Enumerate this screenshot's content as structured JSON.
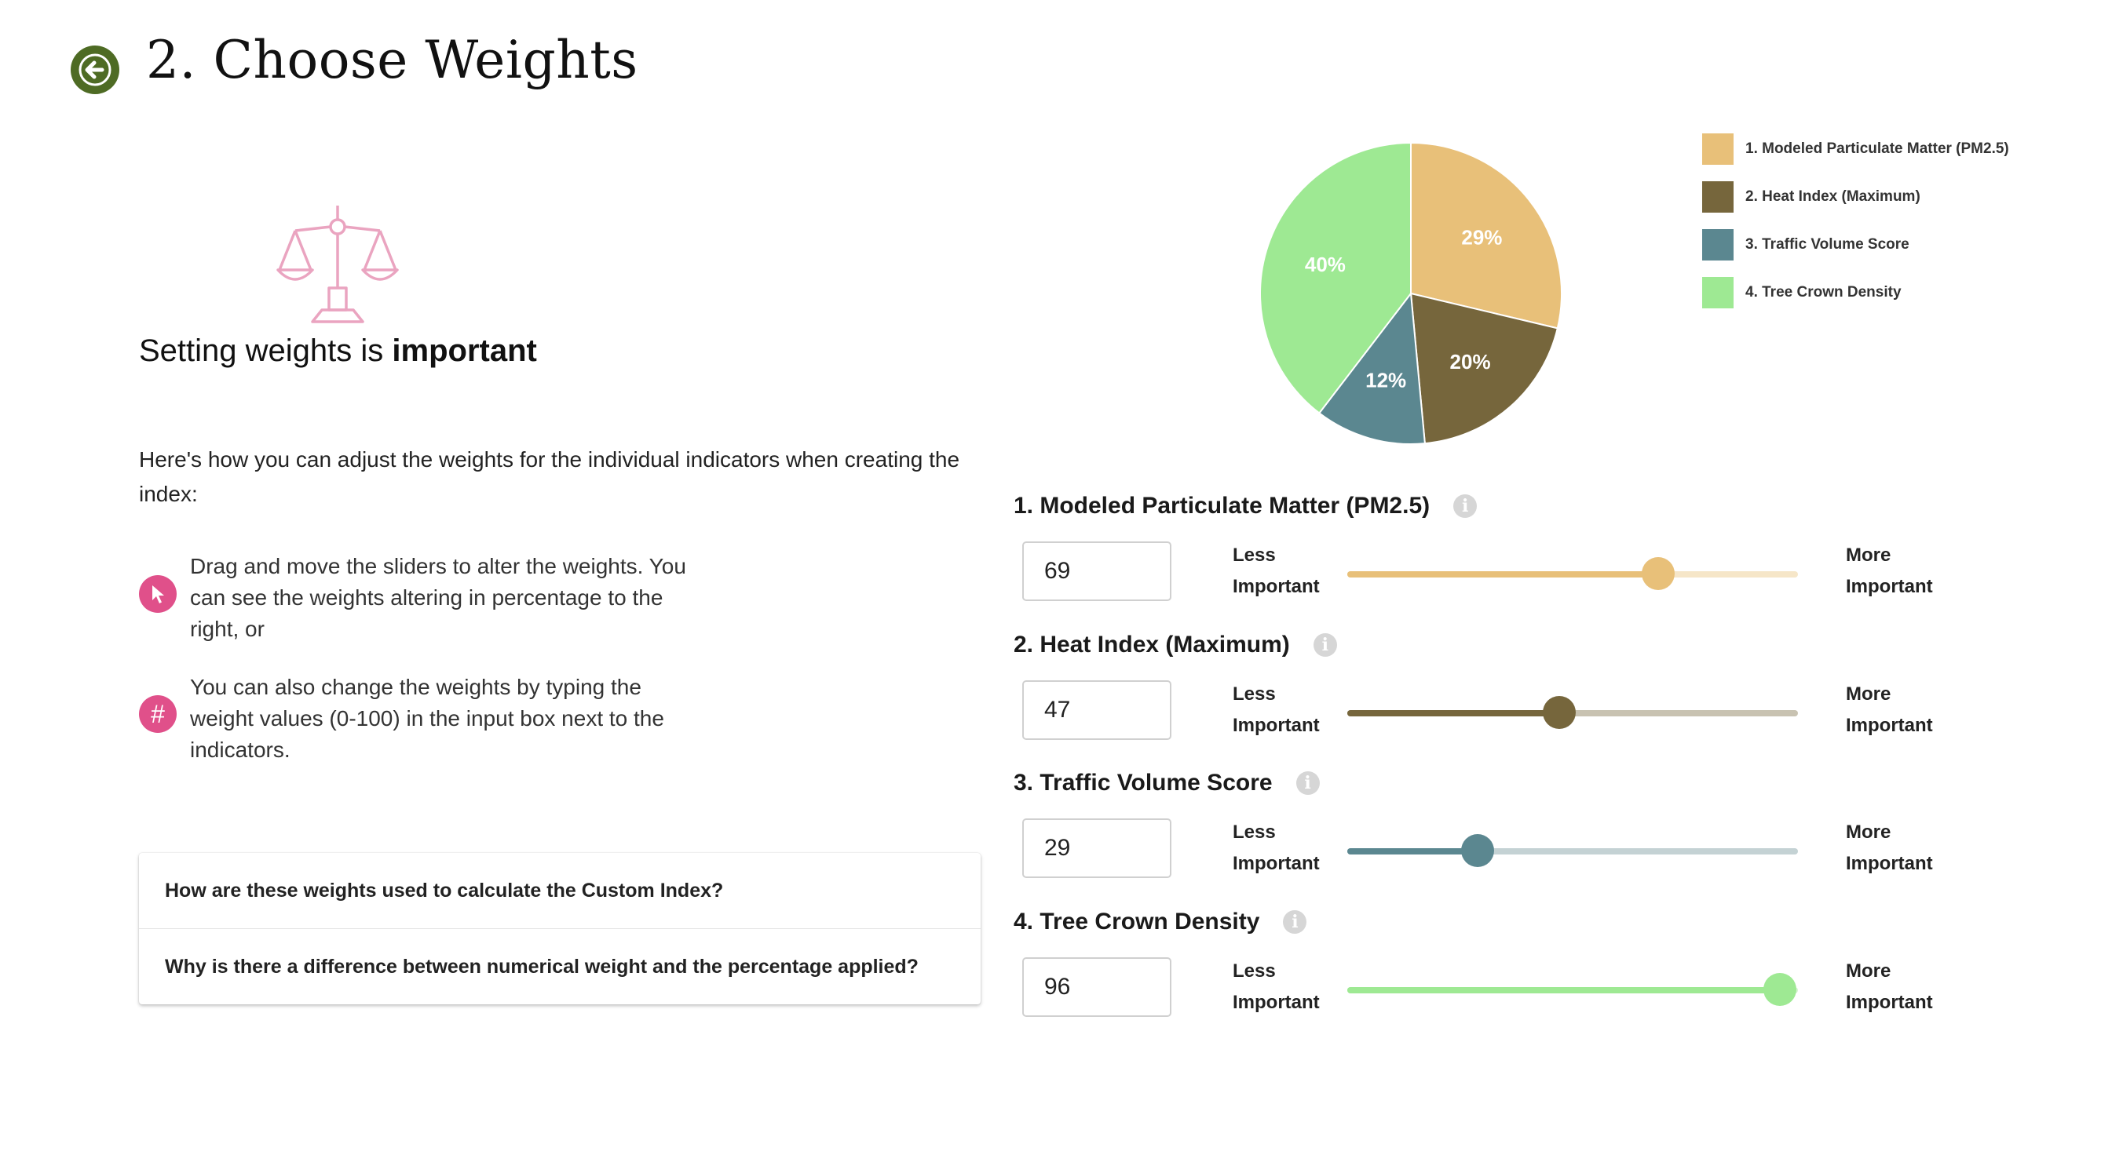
{
  "header": {
    "title": "2. Choose Weights"
  },
  "intro": {
    "heading_prefix": "Setting weights is ",
    "heading_bold": "important",
    "text": "Here's how you can adjust the weights for the individual indicators when creating the index:"
  },
  "tips": [
    {
      "icon": "cursor-icon",
      "text": "Drag and move the sliders to alter the weights. You can see the weights altering in percentage to the right, or"
    },
    {
      "icon": "hash-icon",
      "text": "You can also change the weights by typing the weight values (0-100) in the input box next to the indicators."
    }
  ],
  "faq": [
    "How are these weights used to calculate the Custom Index?",
    "Why is there a difference between numerical weight and the percentage applied?"
  ],
  "labels": {
    "less": [
      "Less",
      "Important"
    ],
    "more": [
      "More",
      "Important"
    ]
  },
  "indicators": [
    {
      "title": "1. Modeled Particulate Matter (PM2.5)",
      "value": "69",
      "slider_fraction": 0.69,
      "color": "#e8c079",
      "light": "#f6e6c8"
    },
    {
      "title": "2. Heat Index (Maximum)",
      "value": "47",
      "slider_fraction": 0.47,
      "color": "#76663c",
      "light": "#c8c2b1"
    },
    {
      "title": "3. Traffic Volume Score",
      "value": "29",
      "slider_fraction": 0.29,
      "color": "#5b8790",
      "light": "#c4d2d4"
    },
    {
      "title": "4. Tree Crown Density",
      "value": "96",
      "slider_fraction": 0.96,
      "color": "#9ee993",
      "light": "#d4f3cf"
    }
  ],
  "chart_data": {
    "type": "pie",
    "labels": [
      "1. Modeled Particulate Matter (PM2.5)",
      "2. Heat Index (Maximum)",
      "3. Traffic Volume Score",
      "4. Tree Crown Density"
    ],
    "values": [
      29,
      20,
      12,
      40
    ],
    "value_labels": [
      "29%",
      "20%",
      "12%",
      "40%"
    ],
    "colors": [
      "#e8c079",
      "#76663c",
      "#5b8790",
      "#9ee993"
    ],
    "legend_position": "right"
  }
}
